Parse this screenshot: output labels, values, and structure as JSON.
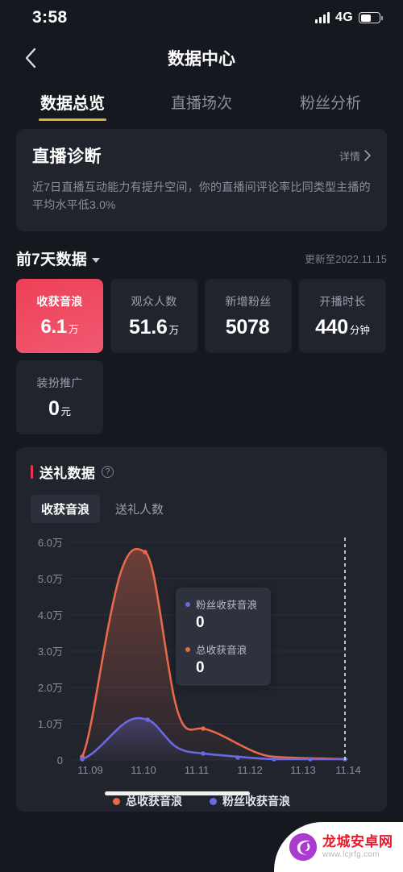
{
  "status_bar": {
    "time": "3:58",
    "network": "4G",
    "signal_icon": "signal-bars-icon",
    "battery_icon": "battery-icon",
    "battery_level": 58
  },
  "nav": {
    "back_icon": "chevron-left-icon",
    "title": "数据中心"
  },
  "main_tabs": [
    {
      "label": "数据总览",
      "active": true
    },
    {
      "label": "直播场次",
      "active": false
    },
    {
      "label": "粉丝分析",
      "active": false
    }
  ],
  "diagnostic": {
    "title": "直播诊断",
    "more_label": "详情",
    "more_icon": "chevron-right-icon",
    "description": "近7日直播互动能力有提升空间，你的直播间评论率比同类型主播的平均水平低3.0%"
  },
  "range_header": {
    "label": "前7天数据",
    "caret_icon": "caret-down-icon",
    "updated": "更新至2022.11.15"
  },
  "stats": [
    {
      "label": "收获音浪",
      "value": "6.1",
      "unit": "万",
      "highlight": true
    },
    {
      "label": "观众人数",
      "value": "51.6",
      "unit": "万",
      "highlight": false
    },
    {
      "label": "新增粉丝",
      "value": "5078",
      "unit": "",
      "highlight": false
    },
    {
      "label": "开播时长",
      "value": "440",
      "unit": "分钟",
      "highlight": false
    },
    {
      "label": "装扮推广",
      "value": "0",
      "unit": "元",
      "highlight": false
    }
  ],
  "gift_panel": {
    "title": "送礼数据",
    "help_icon": "question-mark-icon",
    "tabs": [
      {
        "label": "收获音浪",
        "active": true
      },
      {
        "label": "送礼人数",
        "active": false
      }
    ],
    "tooltip": [
      {
        "name": "粉丝收获音浪",
        "value": "0",
        "color": "#6a6ae0"
      },
      {
        "name": "总收获音浪",
        "value": "0",
        "color": "#e8684a"
      }
    ]
  },
  "chart_data": {
    "type": "line",
    "title": "送礼数据",
    "xlabel": "",
    "ylabel": "",
    "x": [
      "11.09",
      "11.10",
      "11.11",
      "11.12",
      "11.13",
      "11.14"
    ],
    "ytick_labels": [
      "0",
      "1.0万",
      "2.0万",
      "3.0万",
      "4.0万",
      "5.0万",
      "6.0万"
    ],
    "ytick_values": [
      0,
      10000,
      20000,
      30000,
      40000,
      50000,
      60000
    ],
    "ylim": [
      0,
      60000
    ],
    "grid": true,
    "legend_position": "bottom",
    "marker_line": {
      "x": "11.14",
      "style": "dashed",
      "color": "#ffffff"
    },
    "series": [
      {
        "name": "总收获音浪",
        "color": "#e8684a",
        "fill": true,
        "values": [
          900,
          51000,
          8500,
          500,
          200,
          120
        ]
      },
      {
        "name": "粉丝收获音浪",
        "color": "#6a6ae0",
        "fill": true,
        "values": [
          200,
          11200,
          2300,
          300,
          150,
          100
        ]
      }
    ]
  },
  "watermark": {
    "name": "龙城安卓网",
    "url": "www.lcjrfg.com",
    "logo_icon": "dragon-logo-icon"
  }
}
